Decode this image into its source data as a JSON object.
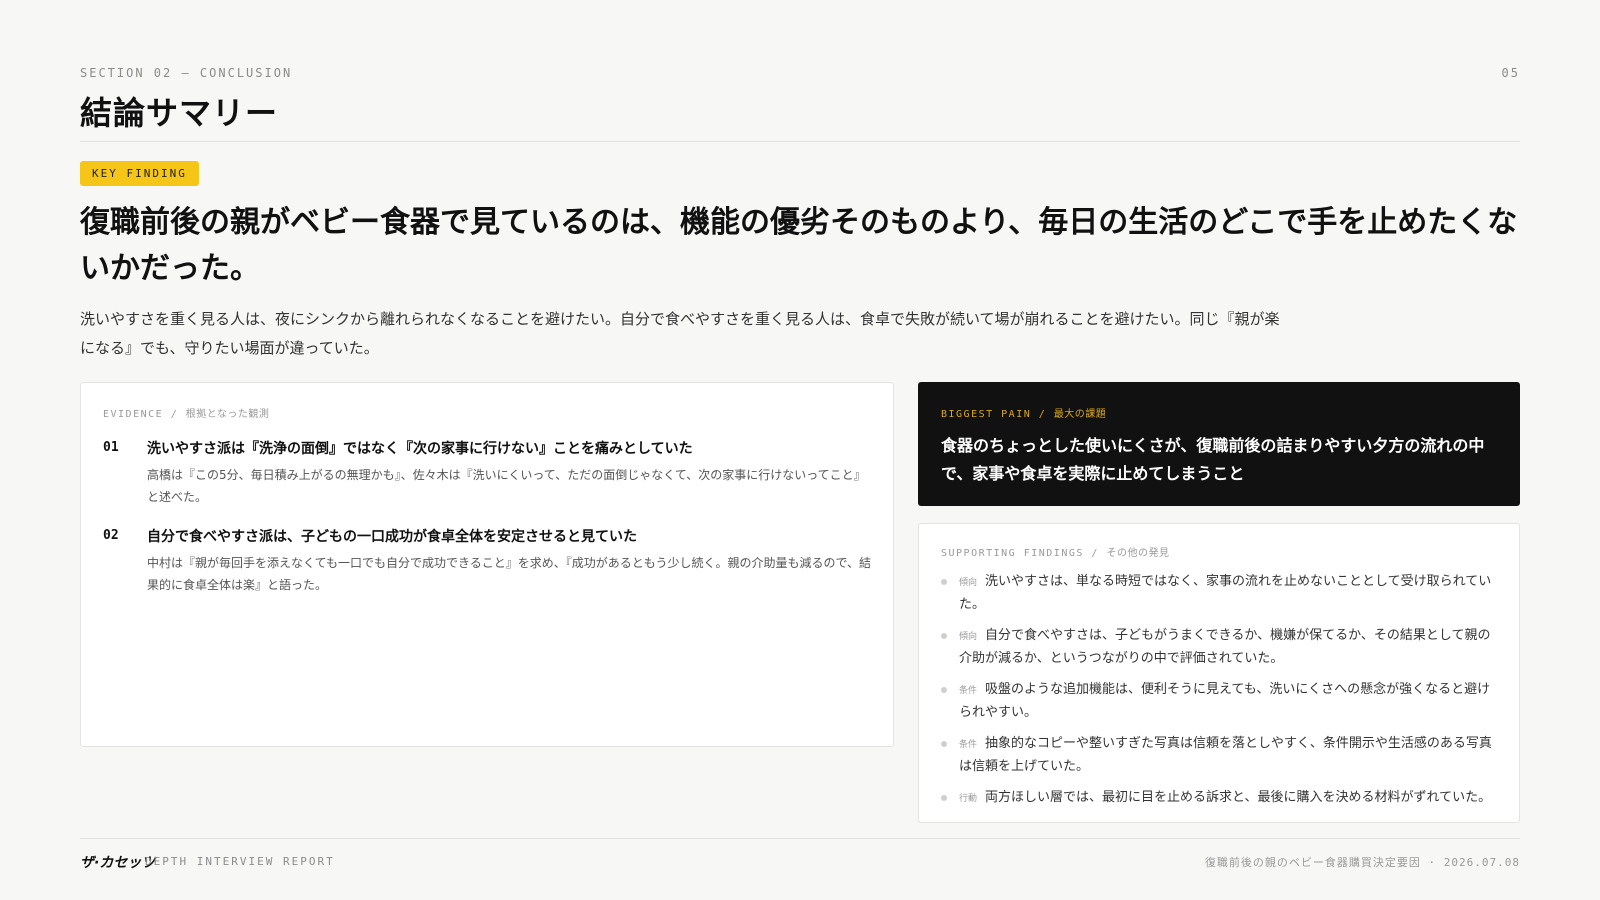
{
  "header": {
    "section_label": "SECTION 02 — CONCLUSION",
    "page_number": "05",
    "title": "結論サマリー"
  },
  "key_finding": {
    "badge": "KEY FINDING",
    "headline": "復職前後の親がベビー食器で見ているのは、機能の優劣そのものより、毎日の生活のどこで手を止めたくないかだった。",
    "lead": "洗いやすさを重く見る人は、夜にシンクから離れられなくなることを避けたい。自分で食べやすさを重く見る人は、食卓で失敗が続いて場が崩れることを避けたい。同じ『親が楽になる』でも、守りたい場面が違っていた。"
  },
  "evidence": {
    "label": "EVIDENCE",
    "label_sub": "根拠となった観測",
    "items": [
      {
        "num": "01",
        "title": "洗いやすさ派は『洗浄の面倒』ではなく『次の家事に行けない』ことを痛みとしていた",
        "text": "高橋は『この5分、毎日積み上がるの無理かも』、佐々木は『洗いにくいって、ただの面倒じゃなくて、次の家事に行けないってこと』と述べた。"
      },
      {
        "num": "02",
        "title": "自分で食べやすさ派は、子どもの一口成功が食卓全体を安定させると見ていた",
        "text": "中村は『親が毎回手を添えなくても一口でも自分で成功できること』を求め、『成功があるともう少し続く。親の介助量も減るので、結果的に食卓全体は楽』と語った。"
      }
    ]
  },
  "biggest_pain": {
    "label": "BIGGEST PAIN",
    "label_sub": "最大の課題",
    "text": "食器のちょっとした使いにくさが、復職前後の詰まりやすい夕方の流れの中で、家事や食卓を実際に止めてしまうこと"
  },
  "supporting": {
    "label": "SUPPORTING FINDINGS",
    "label_sub": "その他の発見",
    "items": [
      {
        "tag": "傾向",
        "text": "洗いやすさは、単なる時短ではなく、家事の流れを止めないこととして受け取られていた。"
      },
      {
        "tag": "傾向",
        "text": "自分で食べやすさは、子どもがうまくできるか、機嫌が保てるか、その結果として親の介助が減るか、というつながりの中で評価されていた。"
      },
      {
        "tag": "条件",
        "text": "吸盤のような追加機能は、便利そうに見えても、洗いにくさへの懸念が強くなると避けられやすい。"
      },
      {
        "tag": "条件",
        "text": "抽象的なコピーや整いすぎた写真は信頼を落としやすく、条件開示や生活感のある写真は信頼を上げていた。"
      },
      {
        "tag": "行動",
        "text": "両方ほしい層では、最初に目を止める訴求と、最後に購入を決める材料がずれていた。"
      }
    ]
  },
  "footer": {
    "brand": "ザ·カセッツ",
    "report_label": "DEPTH INTERVIEW REPORT",
    "right_text": "復職前後の親のベビー食器購買決定要因 · 2026.07.08"
  }
}
